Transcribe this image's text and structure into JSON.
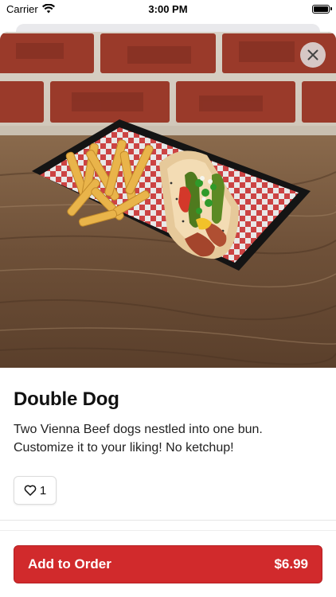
{
  "status_bar": {
    "carrier": "Carrier",
    "time": "3:00 PM"
  },
  "item": {
    "title": "Double Dog",
    "description": "Two Vienna Beef dogs nestled into one bun. Customize it to your liking! No ketchup!",
    "likes": "1",
    "image_subject": "hot-dog-with-fries-photo"
  },
  "order_button": {
    "label": "Add to Order",
    "price": "$6.99"
  },
  "colors": {
    "accent": "#d12a2c",
    "text": "#111111"
  }
}
